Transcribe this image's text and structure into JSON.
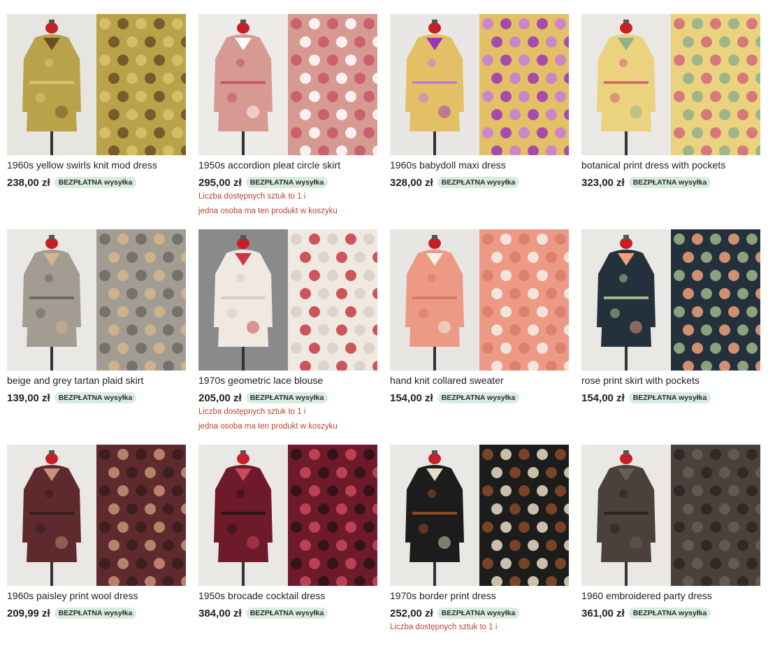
{
  "products": [
    {
      "title": "1960s yellow swirls knit mod dress",
      "price": "238,00 zł",
      "badge": "BEZPŁATNA wysyłka",
      "notices": [],
      "colors": {
        "bg": "#e7e5e0",
        "main": "#b8a24a",
        "accent": "#6e4d26",
        "detail": "#d9c36b"
      }
    },
    {
      "title": "1950s accordion pleat circle skirt",
      "price": "295,00 zł",
      "badge": "BEZPŁATNA wysyłka",
      "notices": [
        "Liczba dostępnych sztuk to 1 i",
        "jedna osoba ma ten produkt w koszyku"
      ],
      "colors": {
        "bg": "#ecebe8",
        "main": "#d79a93",
        "accent": "#ffffff",
        "detail": "#c9566a"
      }
    },
    {
      "title": "1960s babydoll maxi dress",
      "price": "328,00 zł",
      "badge": "BEZPŁATNA wysyłka",
      "notices": [],
      "colors": {
        "bg": "#e8e7e4",
        "main": "#e3c065",
        "accent": "#9b36b8",
        "detail": "#c87ad8"
      }
    },
    {
      "title": "botanical print dress with pockets",
      "price": "323,00 zł",
      "badge": "BEZPŁATNA wysyłka",
      "notices": [],
      "colors": {
        "bg": "#e9e8e5",
        "main": "#ead27e",
        "accent": "#8fb08a",
        "detail": "#d46a7a"
      }
    },
    {
      "title": "beige and grey tartan plaid skirt",
      "price": "139,00 zł",
      "badge": "BEZPŁATNA wysyłka",
      "notices": [],
      "colors": {
        "bg": "#e9e8e5",
        "main": "#a29c93",
        "accent": "#d6b68c",
        "detail": "#6d6a66"
      }
    },
    {
      "title": "1970s geometric lace blouse",
      "price": "205,00 zł",
      "badge": "BEZPŁATNA wysyłka",
      "notices": [
        "Liczba dostępnych sztuk to 1 i",
        "jedna osoba ma ten produkt w koszyku"
      ],
      "colors": {
        "bg": "#8a8a8a",
        "main": "#efe9e2",
        "accent": "#c83a44",
        "detail": "#d8d0c6"
      }
    },
    {
      "title": "hand knit collared sweater",
      "price": "154,00 zł",
      "badge": "BEZPŁATNA wysyłka",
      "notices": [],
      "colors": {
        "bg": "#e7e6e3",
        "main": "#ec9a86",
        "accent": "#f4f1ea",
        "detail": "#d87c68"
      }
    },
    {
      "title": "rose print skirt with pockets",
      "price": "154,00 zł",
      "badge": "BEZPŁATNA wysyłka",
      "notices": [],
      "colors": {
        "bg": "#e9e8e5",
        "main": "#24303c",
        "accent": "#f0a07a",
        "detail": "#9fb58a"
      }
    },
    {
      "title": "1960s paisley print wool dress",
      "price": "209,99 zł",
      "badge": "BEZPŁATNA wysyłka",
      "notices": [],
      "colors": {
        "bg": "#e9e8e5",
        "main": "#5e2a2d",
        "accent": "#c98f78",
        "detail": "#3a1c1f"
      }
    },
    {
      "title": "1950s brocade cocktail dress",
      "price": "384,00 zł",
      "badge": "BEZPŁATNA wysyłka",
      "notices": [],
      "colors": {
        "bg": "#e9e8e5",
        "main": "#6e1a2a",
        "accent": "#c84a5c",
        "detail": "#2a1418"
      }
    },
    {
      "title": "1970s border print dress",
      "price": "252,00 zł",
      "badge": "BEZPŁATNA wysyłka",
      "notices": [
        "Liczba dostępnych sztuk to 1 i"
      ],
      "colors": {
        "bg": "#e9e8e5",
        "main": "#1c1c1c",
        "accent": "#e9dcc4",
        "detail": "#8a4a2a"
      }
    },
    {
      "title": "1960 embroidered party dress",
      "price": "361,00 zł",
      "badge": "BEZPŁATNA wysyłka",
      "notices": [],
      "colors": {
        "bg": "#e9e8e5",
        "main": "#4a413a",
        "accent": "#6a5d52",
        "detail": "#2c2622"
      }
    }
  ]
}
